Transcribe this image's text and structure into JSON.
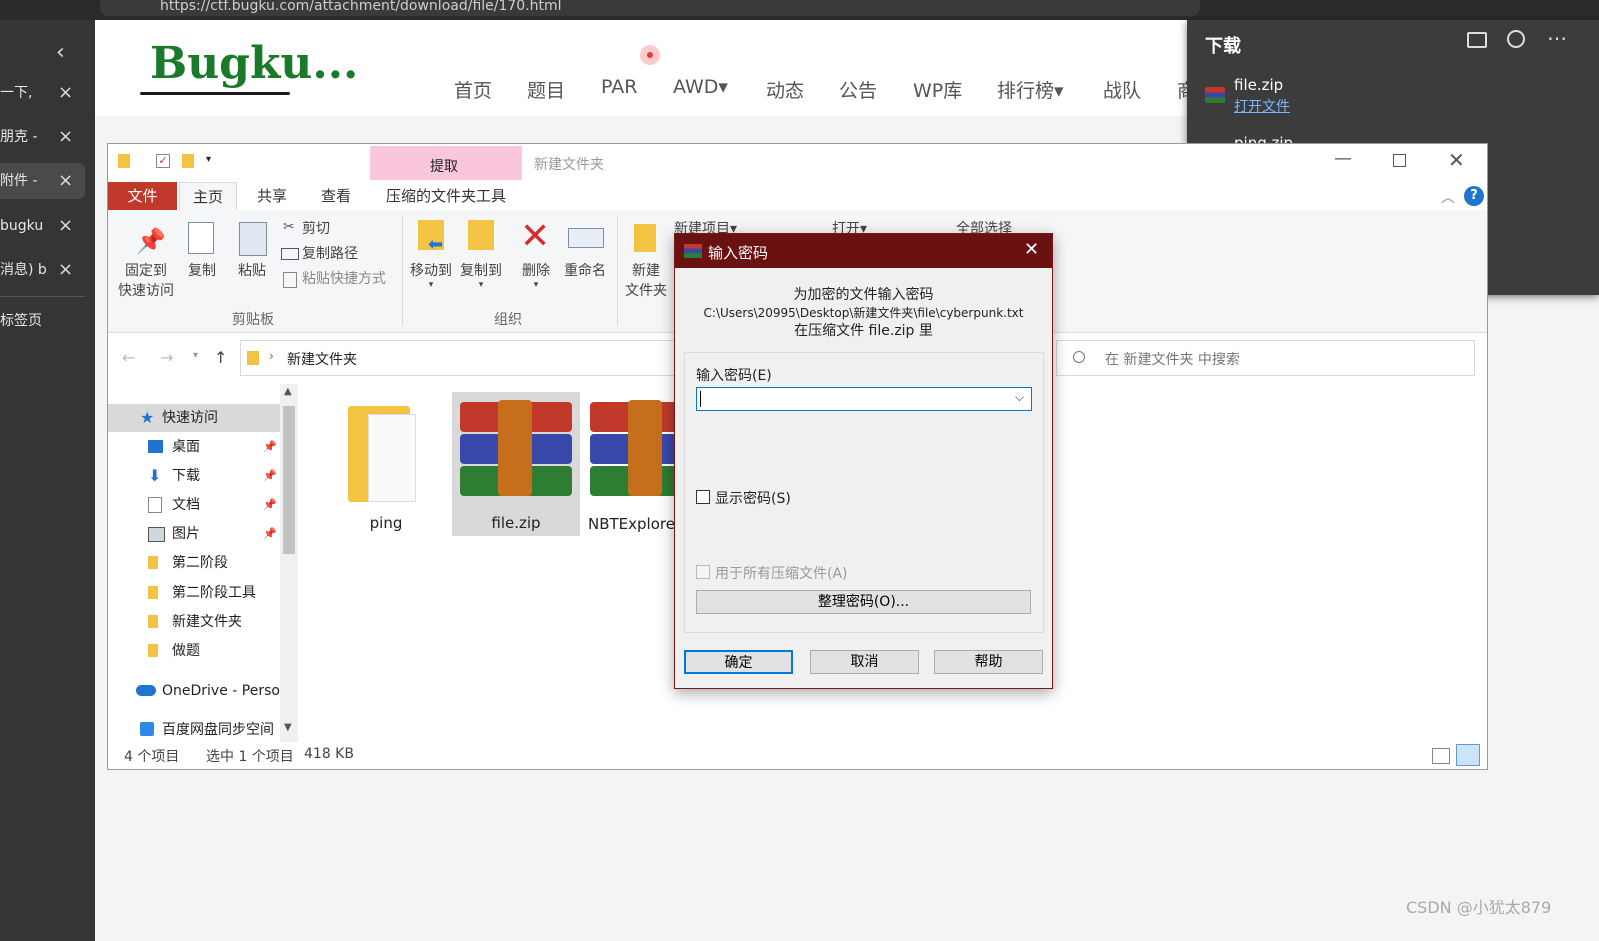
{
  "browser": {
    "url": "https://ctf.bugku.com/attachment/download/file/170.html",
    "vertical_tabs": [
      {
        "label": "一下,",
        "active": false
      },
      {
        "label": "朋克 -",
        "active": false
      },
      {
        "label": "附件 - ",
        "active": true
      },
      {
        "label": "bugku",
        "active": false
      },
      {
        "label": "消息) b",
        "active": false
      }
    ],
    "new_tab_label": "标签页",
    "collapse_symbol": "‹",
    "close_symbol": "×"
  },
  "site": {
    "logo_text": "Bugku...",
    "nav_items": [
      "首页",
      "题目",
      "PAR",
      "AWD▾",
      "动态",
      "公告",
      "WP库",
      "排行榜▾",
      "战队",
      "商"
    ]
  },
  "downloads": {
    "title": "下载",
    "items": [
      {
        "name": "file.zip",
        "action": "打开文件"
      },
      {
        "name": "ping.zip",
        "action": ""
      }
    ]
  },
  "explorer": {
    "title": "新建文件夹",
    "contextual_tab_header": "提取",
    "tabs": [
      "文件",
      "主页",
      "共享",
      "查看",
      "压缩的文件夹工具"
    ],
    "ribbon": {
      "pin_label_1": "固定到",
      "pin_label_2": "快速访问",
      "copy": "复制",
      "paste": "粘贴",
      "cut": "剪切",
      "copy_path": "复制路径",
      "paste_shortcut": "粘贴快捷方式",
      "clipboard_group": "剪贴板",
      "move_to": "移动到",
      "copy_to": "复制到",
      "delete": "删除",
      "rename": "重命名",
      "organize_group": "组织",
      "new_folder_1": "新建",
      "new_folder_2": "文件夹",
      "new_item": "新建项目▾",
      "open": "打开▾",
      "select_all": "全部选择"
    },
    "breadcrumb": "新建文件夹",
    "search_placeholder": "在 新建文件夹 中搜索",
    "sidebar": [
      {
        "label": "快速访问",
        "pinned": false
      },
      {
        "label": "桌面",
        "pinned": true
      },
      {
        "label": "下载",
        "pinned": true
      },
      {
        "label": "文档",
        "pinned": true
      },
      {
        "label": "图片",
        "pinned": true
      },
      {
        "label": "第二阶段",
        "pinned": false
      },
      {
        "label": "第二阶段工具",
        "pinned": false
      },
      {
        "label": "新建文件夹",
        "pinned": false
      },
      {
        "label": "做题",
        "pinned": false
      },
      {
        "label": "OneDrive - Perso",
        "pinned": false
      },
      {
        "label": "百度网盘同步空间",
        "pinned": false
      }
    ],
    "files": [
      {
        "name": "ping",
        "type": "folder",
        "selected": false
      },
      {
        "name": "file.zip",
        "type": "rar",
        "selected": true
      },
      {
        "name": "NBTExplore zip",
        "type": "rar",
        "selected": false
      }
    ],
    "status": {
      "count": "4 个项目",
      "selection": "选中 1 个项目",
      "size": "418 KB"
    }
  },
  "dialog": {
    "title": "输入密码",
    "line1": "为加密的文件输入密码",
    "line2": "C:\\Users\\20995\\Desktop\\新建文件夹\\file\\cyberpunk.txt",
    "line3": "在压缩文件 file.zip 里",
    "password_label": "输入密码(E)",
    "password_value": "",
    "show_password": "显示密码(S)",
    "use_for_all": "用于所有压缩文件(A)",
    "organize": "整理密码(O)...",
    "ok": "确定",
    "cancel": "取消",
    "help": "帮助"
  },
  "watermark": "CSDN @小犹太879",
  "colors": {
    "dialog_title": "#6a1111",
    "explorer_file_tab": "#c0392b",
    "contextual_tab": "#f9c6dd",
    "logo": "#1a7a2a",
    "link": "#7ab7ff"
  }
}
